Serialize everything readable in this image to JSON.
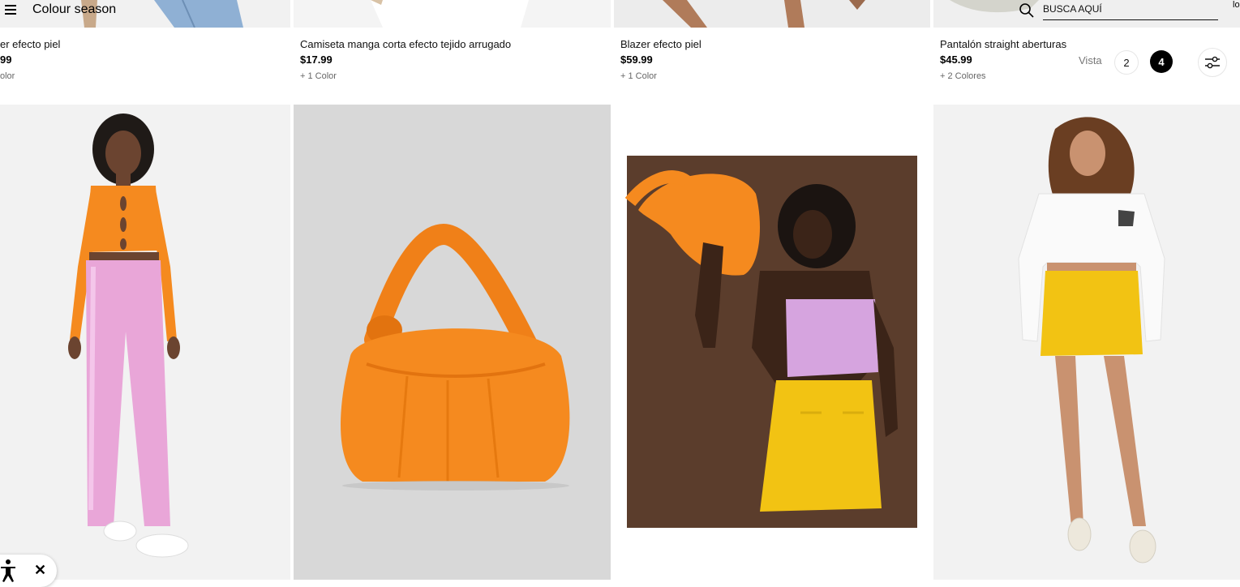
{
  "header": {
    "title": "Colour season",
    "search_placeholder": "BUSCA AQUÍ"
  },
  "products_top": [
    {
      "name": "er efecto piel",
      "price": "99",
      "colors": "olor"
    },
    {
      "name": "Camiseta manga corta efecto tejido arrugado",
      "price": "$17.99",
      "colors": "+ 1 Color"
    },
    {
      "name": "Blazer efecto piel",
      "price": "$59.99",
      "colors": "+ 1 Color"
    },
    {
      "name": "Pantalón straight aberturas",
      "price": "$45.99",
      "colors": "+ 2 Colores"
    }
  ],
  "view": {
    "label": "Vista",
    "option_2": "2",
    "option_4": "4",
    "selected": "4"
  },
  "accessibility": {
    "close_glyph": "✕"
  },
  "colors": {
    "orange": "#f58a1f",
    "pink": "#e9a6d8",
    "yellow": "#f2c313",
    "lilac": "#d6a4df",
    "brown": "#5b3d2c"
  },
  "icons": [
    "menu-icon",
    "search-icon",
    "filter-sliders-icon",
    "accessibility-icon",
    "close-icon"
  ]
}
